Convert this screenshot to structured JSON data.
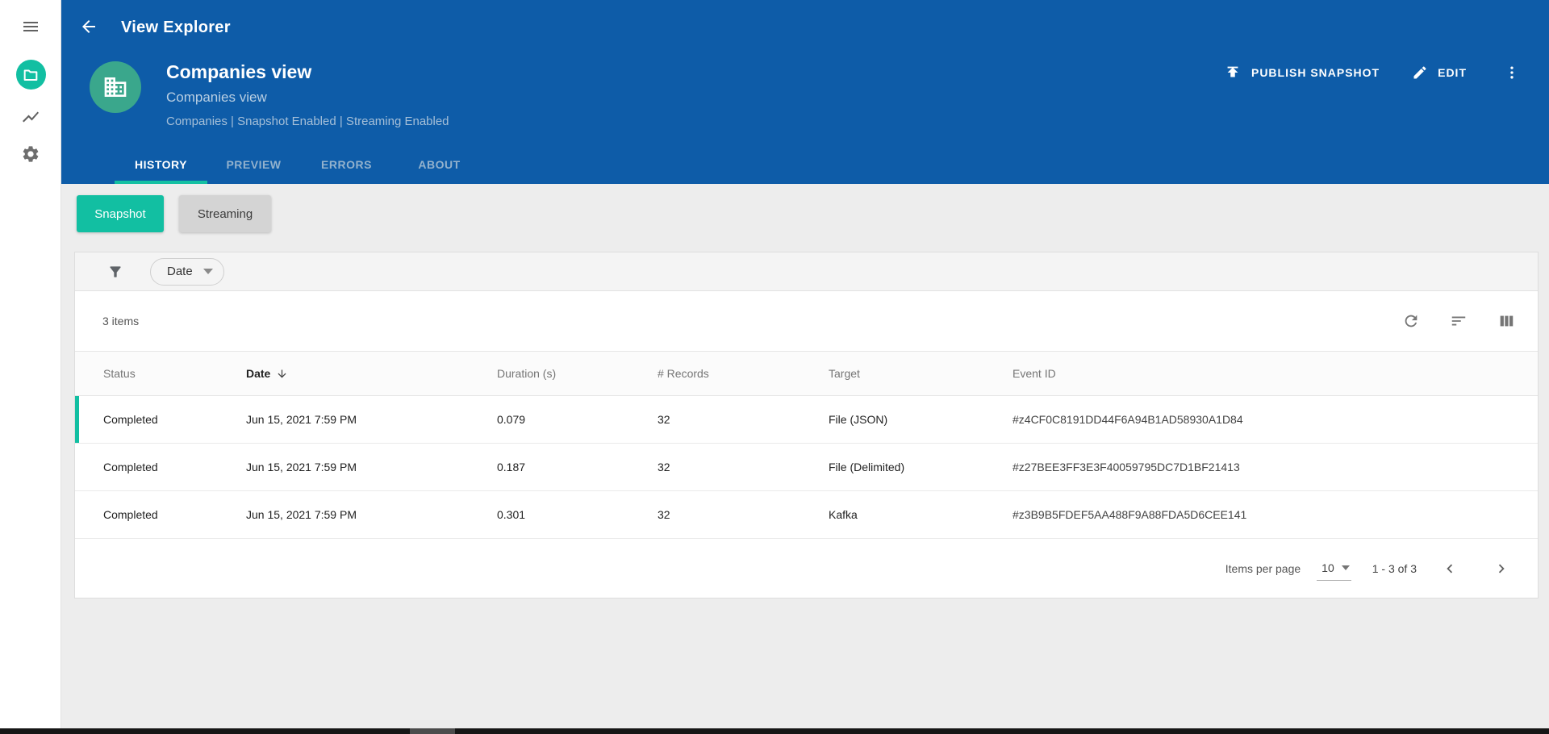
{
  "app": {
    "title": "View Explorer"
  },
  "colors": {
    "header_blue": "#0e5ca8",
    "accent_teal": "#12bfa2",
    "avatar_green": "#3aa78c"
  },
  "icons": {
    "menu": "hamburger",
    "views": "folder",
    "metrics": "line-chart",
    "settings": "gear",
    "back": "arrow-left",
    "publish": "upload-arrow",
    "edit": "pencil",
    "more": "kebab-vertical",
    "avatar": "office-building",
    "filter": "funnel",
    "date_dropdown": "caret-down",
    "refresh": "circular-arrow",
    "sort": "sort-lines",
    "columns": "column-bars",
    "sort_direction": "arrow-down",
    "prev": "chevron-left",
    "next": "chevron-right"
  },
  "header": {
    "title": "Companies view",
    "subtitle": "Companies view",
    "meta": "Companies | Snapshot Enabled | Streaming Enabled",
    "actions": {
      "publish": "PUBLISH SNAPSHOT",
      "edit": "EDIT"
    },
    "tabs": [
      {
        "label": "HISTORY",
        "active": true
      },
      {
        "label": "PREVIEW",
        "active": false
      },
      {
        "label": "ERRORS",
        "active": false
      },
      {
        "label": "ABOUT",
        "active": false
      }
    ]
  },
  "toggles": {
    "snapshot": "Snapshot",
    "streaming": "Streaming"
  },
  "filter": {
    "date_label": "Date"
  },
  "list": {
    "count_label": "3 items"
  },
  "table": {
    "columns": [
      "Status",
      "Date",
      "Duration (s)",
      "# Records",
      "Target",
      "Event ID"
    ],
    "sorted_column": "Date",
    "sort_order": "descending",
    "rows": [
      {
        "status": "Completed",
        "date": "Jun 15, 2021 7:59 PM",
        "duration": "0.079",
        "records": "32",
        "target": "File (JSON)",
        "event_id": "#z4CF0C8191DD44F6A94B1AD58930A1D84"
      },
      {
        "status": "Completed",
        "date": "Jun 15, 2021 7:59 PM",
        "duration": "0.187",
        "records": "32",
        "target": "File (Delimited)",
        "event_id": "#z27BEE3FF3E3F40059795DC7D1BF21413"
      },
      {
        "status": "Completed",
        "date": "Jun 15, 2021 7:59 PM",
        "duration": "0.301",
        "records": "32",
        "target": "Kafka",
        "event_id": "#z3B9B5FDEF5AA488F9A88FDA5D6CEE141"
      }
    ]
  },
  "pagination": {
    "items_per_page_label": "Items per page",
    "page_size": "10",
    "range": "1 - 3 of 3"
  }
}
